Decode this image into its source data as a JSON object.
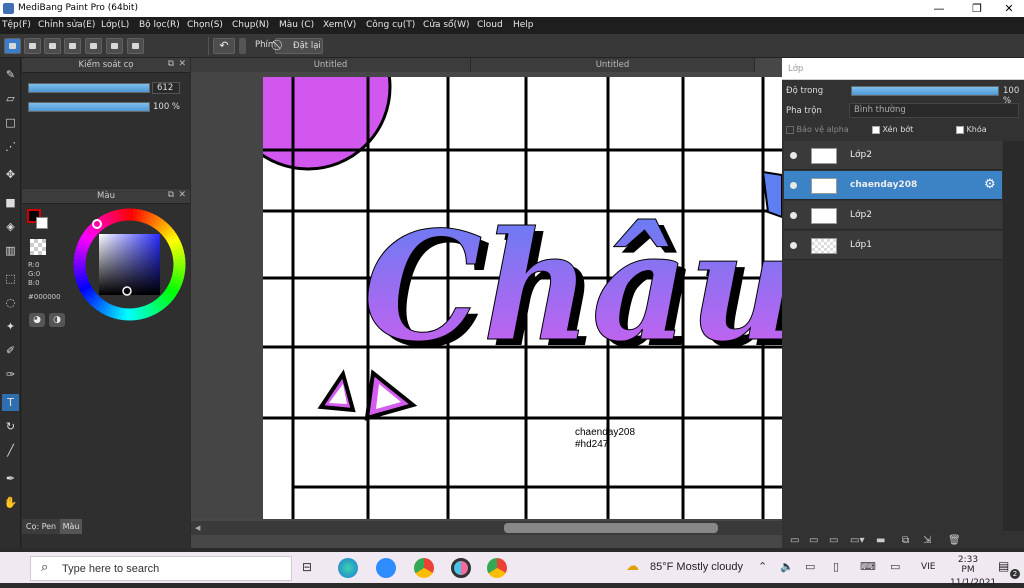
{
  "app": {
    "title": "MediBang Paint Pro (64bit)"
  },
  "window_controls": {
    "minimize": "—",
    "maximize": "❐",
    "close": "✕"
  },
  "menu": [
    "Tệp(F)",
    "Chỉnh sửa(E)",
    "Lớp(L)",
    "Bộ lọc(R)",
    "Chọn(S)",
    "Chụp(N)",
    "Màu (C)",
    "Xem(V)",
    "Công cụ(T)",
    "Cửa sổ(W)",
    "Cloud",
    "Help"
  ],
  "toolbar": {
    "shortcut_label": "Phím",
    "reset_label": "Đặt lại"
  },
  "brush_panel": {
    "title": "Kiểm soát cọ",
    "size_value": "612",
    "opacity_value": "100 %"
  },
  "color_panel": {
    "title": "Màu",
    "r": "R:0",
    "g": "G:0",
    "b": "B:0",
    "hex": "#000000",
    "tab_pen": "Cọ: Pen",
    "tab_color": "Màu"
  },
  "canvas": {
    "tabs": [
      "Untitled",
      "Untitled"
    ],
    "title_text": "Châu",
    "watermark_line1": "chaenday208",
    "watermark_line2": "#hd247"
  },
  "layer_panel": {
    "title": "Lớp",
    "opacity_label": "Độ trong",
    "opacity_value": "100 %",
    "blend_label": "Pha trộn",
    "blend_value": "Bình thường",
    "protect_alpha": "Bảo vệ alpha",
    "clipping": "Xén bớt",
    "lock": "Khóa",
    "layers": [
      {
        "name": "Lớp2",
        "selected": false
      },
      {
        "name": "chaenday208",
        "selected": true
      },
      {
        "name": "Lớp2",
        "selected": false
      },
      {
        "name": "Lớp1",
        "selected": false
      }
    ]
  },
  "taskbar": {
    "search_placeholder": "Type here to search",
    "weather": "85°F  Mostly cloudy",
    "language": "VIE",
    "time": "2:33 PM",
    "date": "11/1/2021",
    "notifications": "2"
  },
  "colors": {
    "accent": "#3b83c4",
    "purple": "#c94ff0",
    "blue_gradient": "#5b7ef3"
  }
}
